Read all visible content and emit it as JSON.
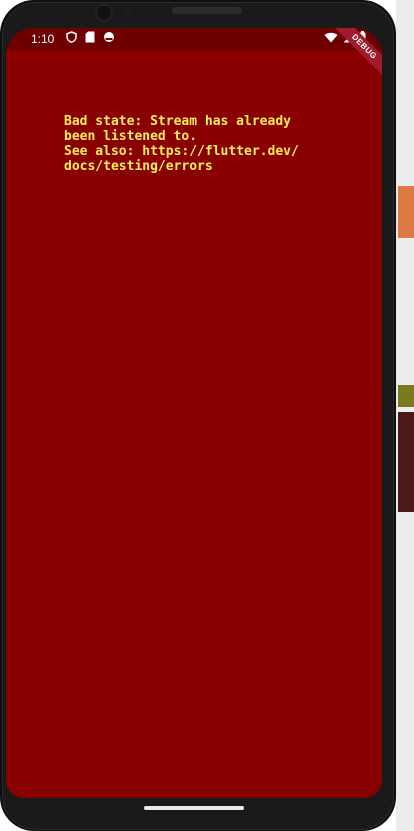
{
  "status_bar": {
    "time": "1:10",
    "left_icons": [
      "shield-icon",
      "sd-card-icon",
      "android-head-icon"
    ],
    "right_icons": [
      "wifi-icon",
      "cell-signal-icon",
      "battery-icon"
    ]
  },
  "debug_banner": {
    "label": "DEBUG"
  },
  "error": {
    "line1": "Bad state: Stream has already",
    "line2": "been listened to.",
    "line3": "See also: https://flutter.dev/",
    "line4": "docs/testing/errors"
  },
  "colors": {
    "screen_background": "#880000",
    "status_background": "#6e0000",
    "error_text": "#ffee58",
    "debug_banner": "#a31a2e"
  }
}
